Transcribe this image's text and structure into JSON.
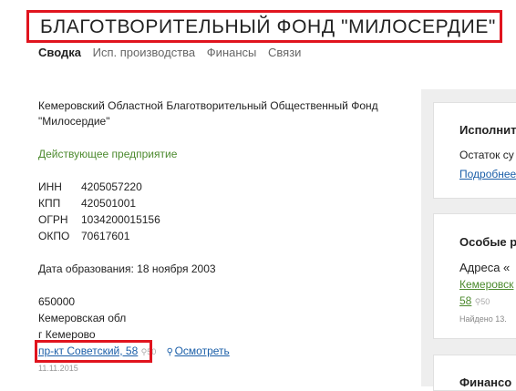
{
  "header": {
    "title": "БЛАГОТВОРИТЕЛЬНЫЙ ФОНД \"МИЛОСЕРДИЕ\""
  },
  "tabs": [
    {
      "label": "Сводка"
    },
    {
      "label": "Исп. производства"
    },
    {
      "label": "Финансы"
    },
    {
      "label": "Связи"
    }
  ],
  "org": {
    "full_name_line1": "Кемеровский Областной Благотворительный Общественный Фонд",
    "full_name_line2": "\"Милосердие\"",
    "status": "Действующее предприятие",
    "ids": [
      {
        "label": "ИНН",
        "value": "4205057220"
      },
      {
        "label": "КПП",
        "value": "420501001"
      },
      {
        "label": "ОГРН",
        "value": "1034200015156"
      },
      {
        "label": "ОКПО",
        "value": "70617601"
      }
    ],
    "founded_label": "Дата образования:",
    "founded_value": "18 ноября 2003",
    "postcode": "650000",
    "region": "Кемеровская обл",
    "city": "г Кемерово",
    "street": "пр-кт Советский, 58",
    "street_rating": "50",
    "view_label": "Осмотреть",
    "address_date": "11.11.2015"
  },
  "sidebar": {
    "card1": {
      "title": "Исполнит",
      "text": "Остаток су",
      "link": "Подробнее"
    },
    "card2": {
      "title": "Особые р",
      "text": "Адреса «",
      "glink1": "Кемеровск",
      "glink2": "58",
      "rating": "50",
      "found": "Найдено 13."
    },
    "card3": {
      "title": "Финансо"
    }
  }
}
